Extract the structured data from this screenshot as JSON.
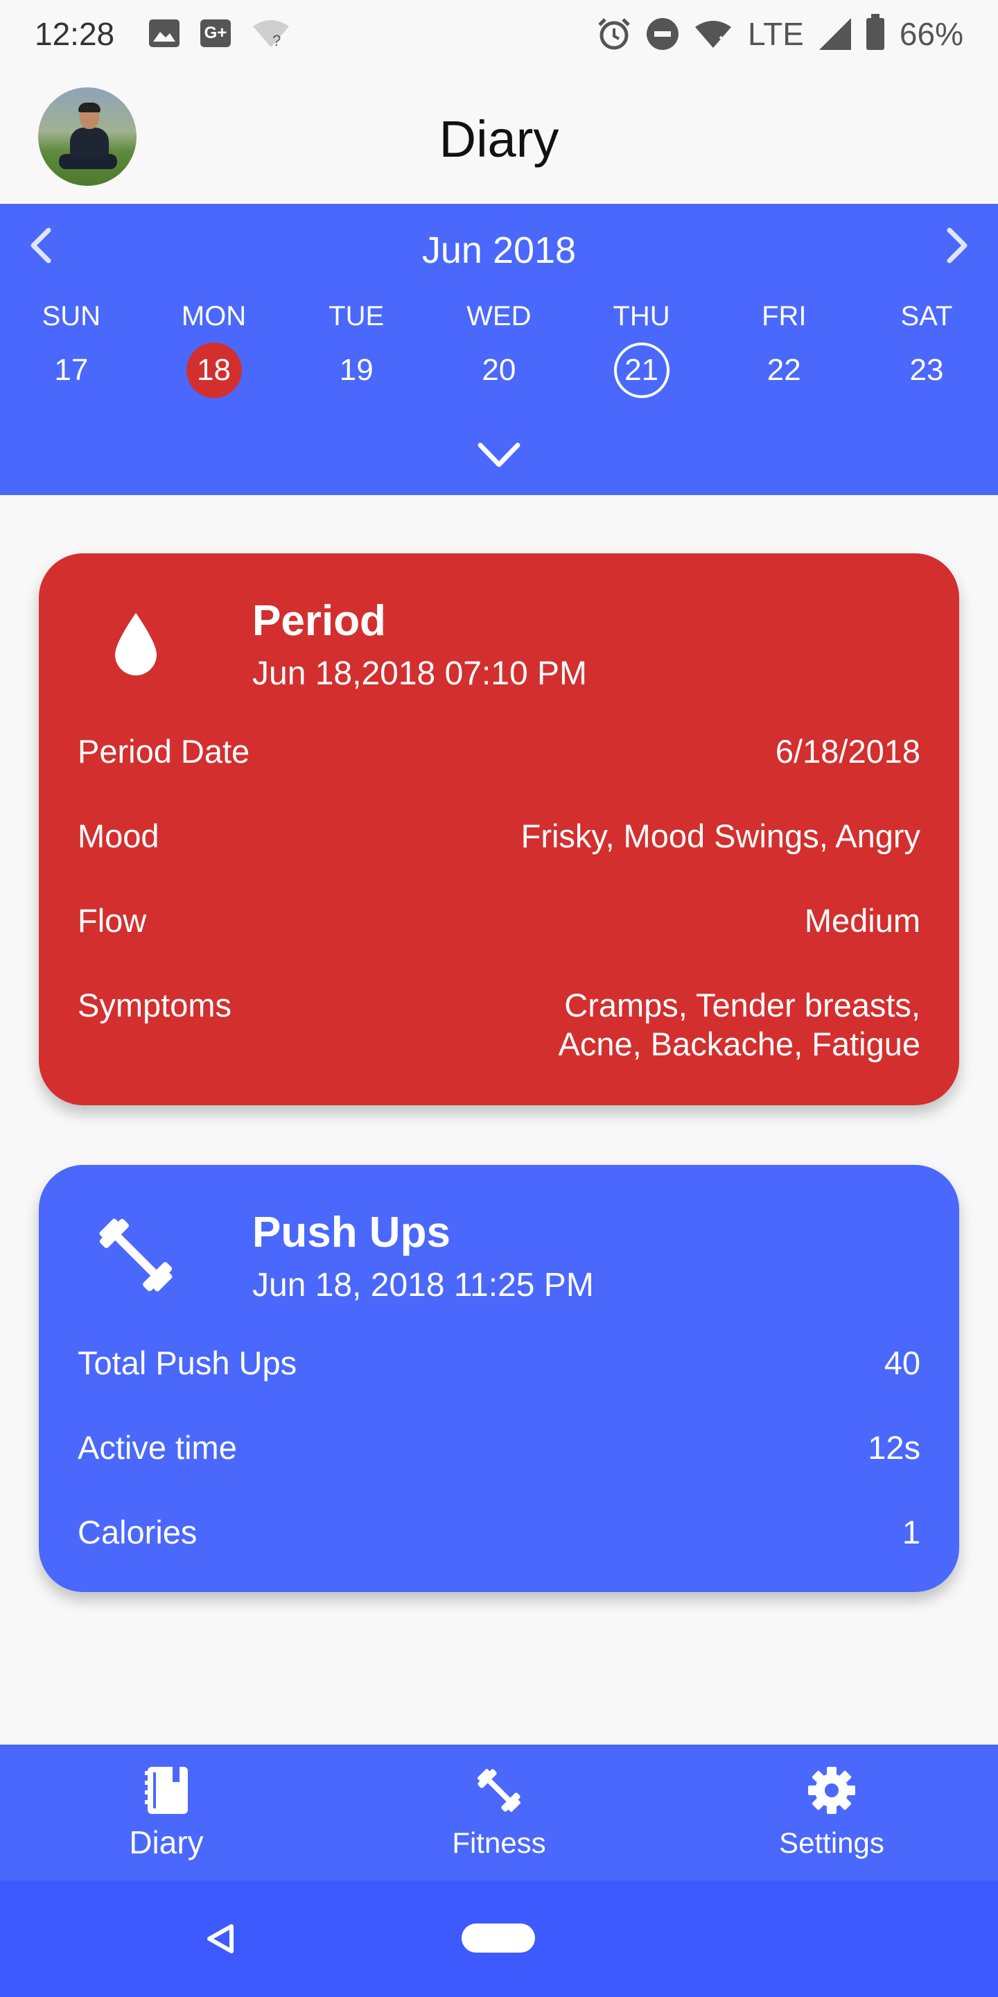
{
  "status_bar": {
    "time": "12:28",
    "network": "LTE",
    "battery": "66%",
    "icons": [
      "image-icon",
      "google-plus-icon",
      "wifi-unknown-icon",
      "alarm-icon",
      "do-not-disturb-icon",
      "wifi-icon",
      "signal-icon",
      "battery-icon"
    ]
  },
  "header": {
    "title": "Diary",
    "avatar_icon": "user-avatar"
  },
  "calendar": {
    "month": "Jun 2018",
    "days": [
      "SUN",
      "MON",
      "TUE",
      "WED",
      "THU",
      "FRI",
      "SAT"
    ],
    "dates": [
      "17",
      "18",
      "19",
      "20",
      "21",
      "22",
      "23"
    ],
    "selected_date": "18",
    "today_date": "21",
    "prev_icon": "chevron-left-icon",
    "next_icon": "chevron-right-icon",
    "expand_icon": "chevron-down-icon"
  },
  "cards": {
    "period": {
      "title": "Period",
      "datetime": "Jun 18,2018 07:10 PM",
      "icon": "drop-icon",
      "color": "#d32f2f",
      "rows": [
        {
          "label": "Period Date",
          "value": "6/18/2018"
        },
        {
          "label": "Mood",
          "value": "Frisky, Mood Swings, Angry"
        },
        {
          "label": "Flow",
          "value": "Medium"
        },
        {
          "label": "Symptoms",
          "value": "Cramps, Tender breasts, Acne, Backache, Fatigue"
        }
      ]
    },
    "pushups": {
      "title": "Push Ups",
      "datetime": "Jun 18, 2018 11:25 PM",
      "icon": "dumbbell-icon",
      "color": "#4a68fc",
      "rows": [
        {
          "label": "Total Push Ups",
          "value": "40"
        },
        {
          "label": "Active time",
          "value": "12s"
        },
        {
          "label": "Calories",
          "value": "1"
        }
      ]
    }
  },
  "bottom_nav": {
    "items": [
      {
        "label": "Diary",
        "icon": "diary-icon",
        "active": true
      },
      {
        "label": "Fitness",
        "icon": "dumbbell-icon",
        "active": false
      },
      {
        "label": "Settings",
        "icon": "gear-icon",
        "active": false
      }
    ]
  },
  "system_nav": {
    "back_icon": "back-icon",
    "home_icon": "home-pill-icon"
  },
  "colors": {
    "primary": "#4a68fc",
    "period_red": "#d32f2f",
    "background": "#f8f8f8",
    "system_nav": "#3d5afe"
  }
}
